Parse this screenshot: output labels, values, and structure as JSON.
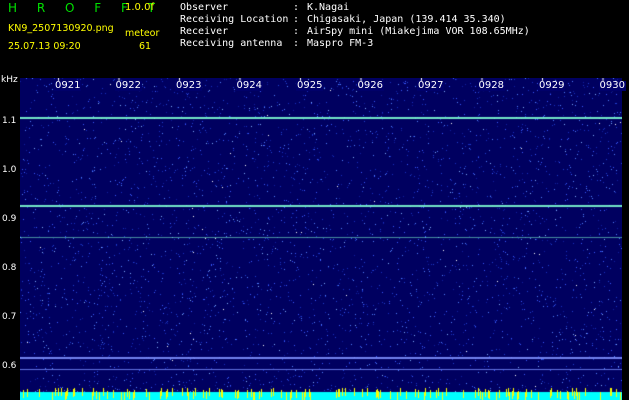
{
  "header": {
    "logo": "H R O F F T",
    "version": "1.0.0f",
    "filename": "KN9_2507130920.png",
    "program": "meteor",
    "datetime": "25.07.13 09:20",
    "count": "61"
  },
  "info": [
    {
      "key": "Observer",
      "sep": ":",
      "value": "K.Nagai"
    },
    {
      "key": "Receiving Location",
      "sep": ":",
      "value": "Chigasaki, Japan (139.414 35.340)"
    },
    {
      "key": "Receiver",
      "sep": ":",
      "value": "AirSpy mini (Miakejima VOR 108.65MHz)"
    },
    {
      "key": "Receiving antenna",
      "sep": ":",
      "value": "Maspro FM-3"
    }
  ],
  "spectrogram": {
    "unit": "kHz",
    "y_ticks": [
      "1.1",
      "1.0",
      "0.9",
      "0.8",
      "0.7",
      "0.6"
    ],
    "y_tick_values": [
      1.1,
      1.0,
      0.9,
      0.8,
      0.7,
      0.6
    ],
    "y_range": [
      0.57,
      1.18
    ],
    "time_labels": [
      "0921",
      "0922",
      "0923",
      "0924",
      "0925",
      "0926",
      "0927",
      "0928",
      "0929",
      "0930"
    ],
    "carrier_lines_khz": [
      1.11,
      0.93,
      0.865,
      0.62
    ],
    "colors": {
      "background": "#000060",
      "noise": "#3a5aff",
      "line": "#7fffd4",
      "strip": "#00ffff"
    }
  }
}
